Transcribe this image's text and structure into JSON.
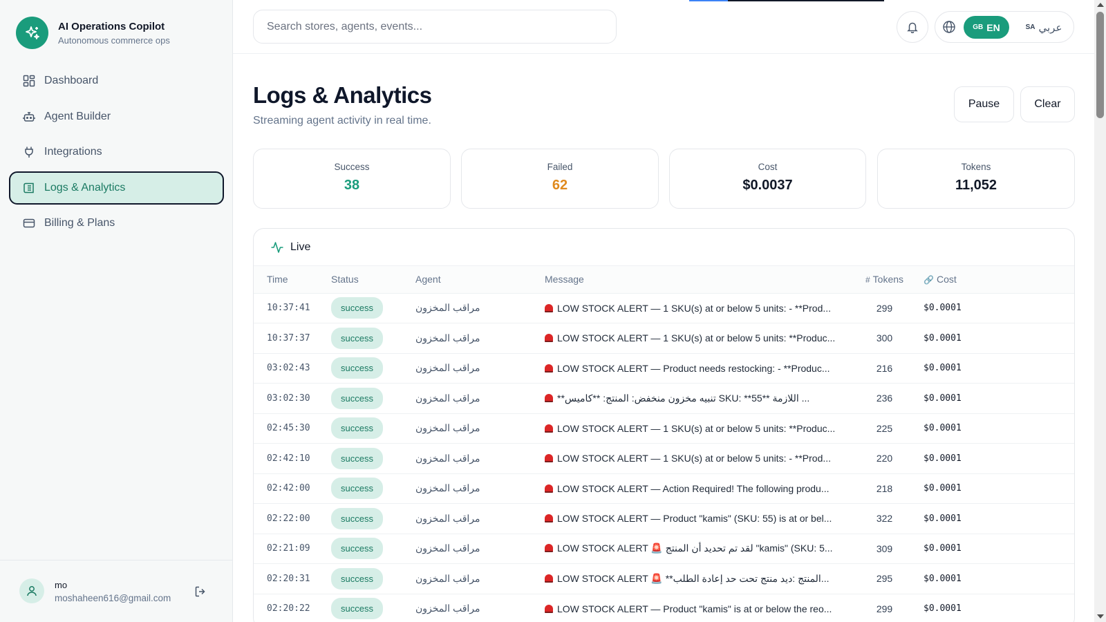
{
  "brand": {
    "title": "AI Operations Copilot",
    "subtitle": "Autonomous commerce ops",
    "logo_icon": "sparkles-icon",
    "color": "#1a9c7c"
  },
  "sidebar": {
    "items": [
      {
        "label": "Dashboard",
        "icon": "dashboard-icon",
        "active": false
      },
      {
        "label": "Agent Builder",
        "icon": "bot-icon",
        "active": false
      },
      {
        "label": "Integrations",
        "icon": "plug-icon",
        "active": false
      },
      {
        "label": "Logs & Analytics",
        "icon": "logs-icon",
        "active": true
      },
      {
        "label": "Billing & Plans",
        "icon": "credit-card-icon",
        "active": false
      }
    ]
  },
  "user": {
    "name": "mo",
    "email": "moshaheen616@gmail.com"
  },
  "header": {
    "search_placeholder": "Search stores, agents, events...",
    "lang_en_code": "GB",
    "lang_en_label": "EN",
    "lang_ar_code": "SA",
    "lang_ar_label": "عربي"
  },
  "page": {
    "title": "Logs & Analytics",
    "subtitle": "Streaming agent activity in real time.",
    "pause_label": "Pause",
    "clear_label": "Clear"
  },
  "stats": [
    {
      "label": "Success",
      "value": "38",
      "color": "#1a9c7c"
    },
    {
      "label": "Failed",
      "value": "62",
      "color": "#e08a1e"
    },
    {
      "label": "Cost",
      "value": "$0.0037",
      "color": "#111827"
    },
    {
      "label": "Tokens",
      "value": "11,052",
      "color": "#111827"
    }
  ],
  "live": {
    "label": "Live",
    "columns": {
      "time": "Time",
      "status": "Status",
      "agent": "Agent",
      "message": "Message",
      "tokens": "Tokens",
      "cost": "Cost"
    },
    "rows": [
      {
        "time": "10:37:41",
        "status": "success",
        "agent": "مراقب المخزون",
        "message": "LOW STOCK ALERT — 1 SKU(s) at or below 5 units: - **Prod...",
        "tokens": "299",
        "cost": "$0.0001"
      },
      {
        "time": "10:37:37",
        "status": "success",
        "agent": "مراقب المخزون",
        "message": "LOW STOCK ALERT — 1 SKU(s) at or below 5 units: **Produc...",
        "tokens": "300",
        "cost": "$0.0001"
      },
      {
        "time": "03:02:43",
        "status": "success",
        "agent": "مراقب المخزون",
        "message": "LOW STOCK ALERT — Product needs restocking: - **Produc...",
        "tokens": "216",
        "cost": "$0.0001"
      },
      {
        "time": "03:02:30",
        "status": "success",
        "agent": "مراقب المخزون",
        "message": "**تنبيه مخزون منخفض: المنتج: **كاميس SKU: **55** اللازمة ...",
        "tokens": "236",
        "cost": "$0.0001"
      },
      {
        "time": "02:45:30",
        "status": "success",
        "agent": "مراقب المخزون",
        "message": "LOW STOCK ALERT — 1 SKU(s) at or below 5 units: **Produc...",
        "tokens": "225",
        "cost": "$0.0001"
      },
      {
        "time": "02:42:10",
        "status": "success",
        "agent": "مراقب المخزون",
        "message": "LOW STOCK ALERT — 1 SKU(s) at or below 5 units: - **Prod...",
        "tokens": "220",
        "cost": "$0.0001"
      },
      {
        "time": "02:42:00",
        "status": "success",
        "agent": "مراقب المخزون",
        "message": "LOW STOCK ALERT — Action Required! The following produ...",
        "tokens": "218",
        "cost": "$0.0001"
      },
      {
        "time": "02:22:00",
        "status": "success",
        "agent": "مراقب المخزون",
        "message": "LOW STOCK ALERT — Product \"kamis\" (SKU: 55) is at or bel...",
        "tokens": "322",
        "cost": "$0.0001"
      },
      {
        "time": "02:21:09",
        "status": "success",
        "agent": "مراقب المخزون",
        "message": "LOW STOCK ALERT 🚨 لقد تم تحديد أن المنتج \"kamis\" (SKU: 5...",
        "tokens": "309",
        "cost": "$0.0001"
      },
      {
        "time": "02:20:31",
        "status": "success",
        "agent": "مراقب المخزون",
        "message": "LOW STOCK ALERT 🚨 **المنتج :ديد منتج تحت حد إعادة الطلب...",
        "tokens": "295",
        "cost": "$0.0001"
      },
      {
        "time": "02:20:22",
        "status": "success",
        "agent": "مراقب المخزون",
        "message": "LOW STOCK ALERT — Product \"kamis\" is at or below the reo...",
        "tokens": "299",
        "cost": "$0.0001"
      }
    ]
  }
}
